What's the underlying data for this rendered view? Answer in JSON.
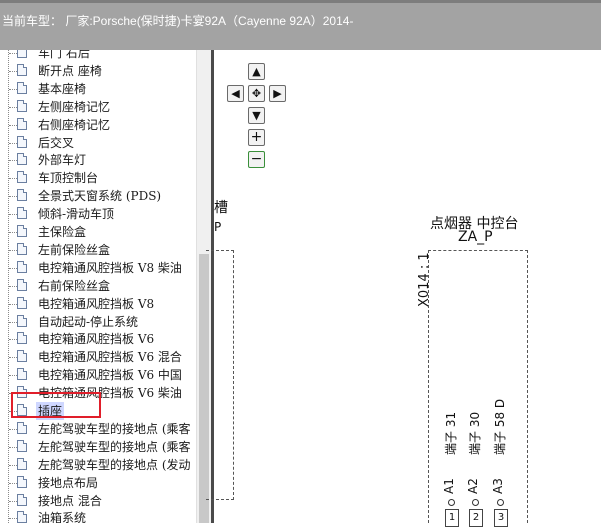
{
  "header": {
    "title": "当前车型： 厂家:Porsche(保时捷)卡宴92A（Cayenne 92A）2014-"
  },
  "tree": {
    "items": [
      {
        "label": "车门 右后"
      },
      {
        "label": "断开点 座椅"
      },
      {
        "label": "基本座椅"
      },
      {
        "label": "左侧座椅记忆"
      },
      {
        "label": "右侧座椅记忆"
      },
      {
        "label": "后交叉"
      },
      {
        "label": "外部车灯"
      },
      {
        "label": "车顶控制台"
      },
      {
        "label": "全景式天窗系统 (PDS)"
      },
      {
        "label": "倾斜-滑动车顶"
      },
      {
        "label": "主保险盒"
      },
      {
        "label": "左前保险丝盒"
      },
      {
        "label": "电控箱通风腔挡板 V8 柴油"
      },
      {
        "label": "右前保险丝盒"
      },
      {
        "label": "电控箱通风腔挡板 V8"
      },
      {
        "label": "自动起动-停止系统"
      },
      {
        "label": "电控箱通风腔挡板 V6"
      },
      {
        "label": "电控箱通风腔挡板 V6 混合"
      },
      {
        "label": "电控箱通风腔挡板 V6 中国"
      },
      {
        "label": "电控箱通风腔挡板 V6 柴油"
      },
      {
        "label": "插座",
        "selected": true
      },
      {
        "label": "左舵驾驶车型的接地点 (乘客"
      },
      {
        "label": "左舵驾驶车型的接地点 (乘客"
      },
      {
        "label": "左舵驾驶车型的接地点 (发动"
      },
      {
        "label": "接地点布局"
      },
      {
        "label": "接地点 混合"
      },
      {
        "label": "油箱系统"
      }
    ]
  },
  "nav": {
    "up": "▲",
    "left": "◀",
    "center": "✥",
    "right": "▶",
    "down": "▼",
    "zoom_in": "+",
    "zoom_out": "−"
  },
  "diagram": {
    "left_partial_1": "槽",
    "left_partial_2": "P",
    "component_label": "点烟器 中控台",
    "component_code": "ZA_P",
    "connector_id": "X014 : 1",
    "pins": [
      {
        "id": "A1",
        "desc": "端子 31",
        "num": "1"
      },
      {
        "id": "A2",
        "desc": "端子 30",
        "num": "2"
      },
      {
        "id": "A3",
        "desc": "端子 58 D",
        "num": "3"
      }
    ]
  }
}
